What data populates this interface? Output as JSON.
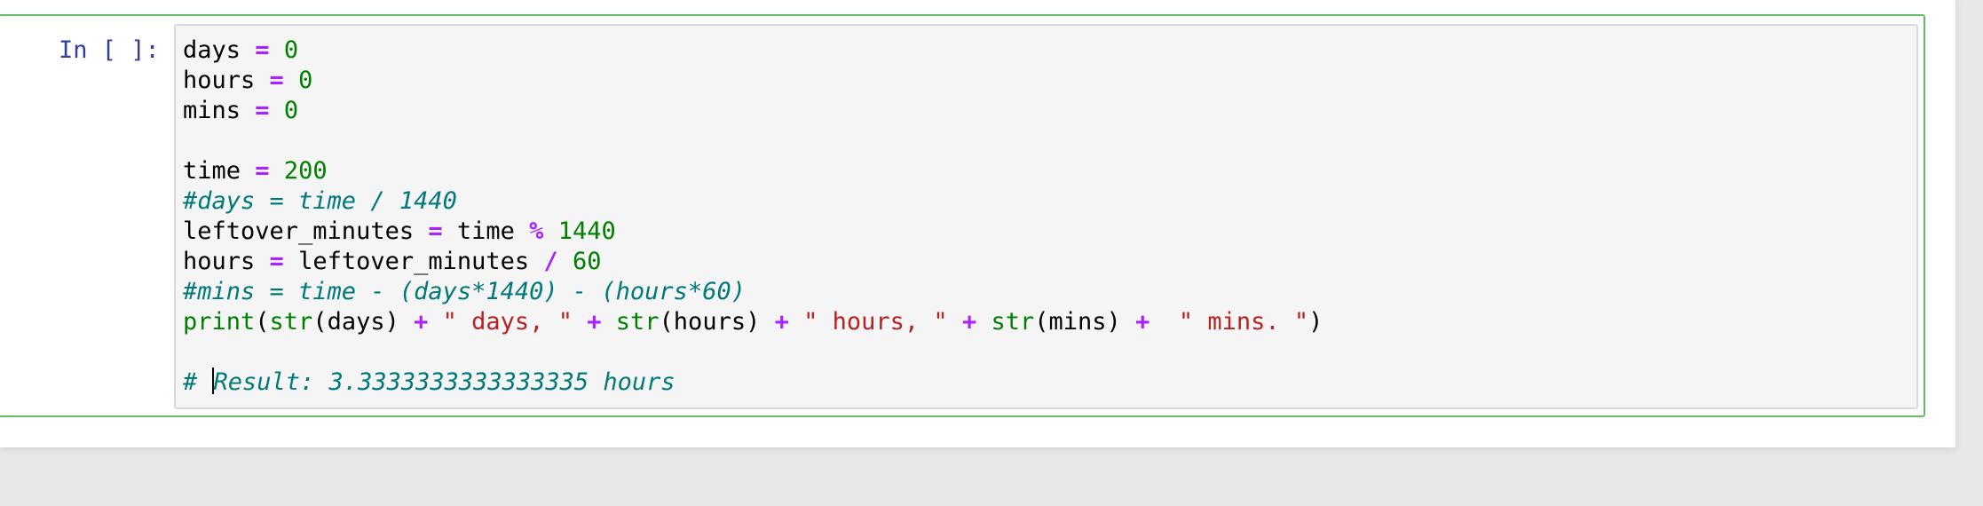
{
  "cell": {
    "prompt": "In [ ]:",
    "lines": [
      {
        "tokens": [
          {
            "t": "days",
            "c": "plain"
          },
          {
            "t": " ",
            "c": "plain"
          },
          {
            "t": "=",
            "c": "op"
          },
          {
            "t": " ",
            "c": "plain"
          },
          {
            "t": "0",
            "c": "num"
          }
        ]
      },
      {
        "tokens": [
          {
            "t": "hours",
            "c": "plain"
          },
          {
            "t": " ",
            "c": "plain"
          },
          {
            "t": "=",
            "c": "op"
          },
          {
            "t": " ",
            "c": "plain"
          },
          {
            "t": "0",
            "c": "num"
          }
        ]
      },
      {
        "tokens": [
          {
            "t": "mins",
            "c": "plain"
          },
          {
            "t": " ",
            "c": "plain"
          },
          {
            "t": "=",
            "c": "op"
          },
          {
            "t": " ",
            "c": "plain"
          },
          {
            "t": "0",
            "c": "num"
          }
        ]
      },
      {
        "tokens": []
      },
      {
        "tokens": [
          {
            "t": "time",
            "c": "plain"
          },
          {
            "t": " ",
            "c": "plain"
          },
          {
            "t": "=",
            "c": "op"
          },
          {
            "t": " ",
            "c": "plain"
          },
          {
            "t": "200",
            "c": "num"
          }
        ]
      },
      {
        "tokens": [
          {
            "t": "#days = time / 1440",
            "c": "comment"
          }
        ]
      },
      {
        "tokens": [
          {
            "t": "leftover_minutes",
            "c": "plain"
          },
          {
            "t": " ",
            "c": "plain"
          },
          {
            "t": "=",
            "c": "op"
          },
          {
            "t": " time ",
            "c": "plain"
          },
          {
            "t": "%",
            "c": "op"
          },
          {
            "t": " ",
            "c": "plain"
          },
          {
            "t": "1440",
            "c": "num"
          }
        ]
      },
      {
        "tokens": [
          {
            "t": "hours",
            "c": "plain"
          },
          {
            "t": " ",
            "c": "plain"
          },
          {
            "t": "=",
            "c": "op"
          },
          {
            "t": " leftover_minutes ",
            "c": "plain"
          },
          {
            "t": "/",
            "c": "op"
          },
          {
            "t": " ",
            "c": "plain"
          },
          {
            "t": "60",
            "c": "num"
          }
        ]
      },
      {
        "tokens": [
          {
            "t": "#mins = time - (days*1440) - (hours*60)",
            "c": "comment"
          }
        ]
      },
      {
        "tokens": [
          {
            "t": "print",
            "c": "builtin"
          },
          {
            "t": "(",
            "c": "plain"
          },
          {
            "t": "str",
            "c": "builtin"
          },
          {
            "t": "(days) ",
            "c": "plain"
          },
          {
            "t": "+",
            "c": "op"
          },
          {
            "t": " ",
            "c": "plain"
          },
          {
            "t": "\" days, \"",
            "c": "str"
          },
          {
            "t": " ",
            "c": "plain"
          },
          {
            "t": "+",
            "c": "op"
          },
          {
            "t": " ",
            "c": "plain"
          },
          {
            "t": "str",
            "c": "builtin"
          },
          {
            "t": "(hours) ",
            "c": "plain"
          },
          {
            "t": "+",
            "c": "op"
          },
          {
            "t": " ",
            "c": "plain"
          },
          {
            "t": "\" hours, \"",
            "c": "str"
          },
          {
            "t": " ",
            "c": "plain"
          },
          {
            "t": "+",
            "c": "op"
          },
          {
            "t": " ",
            "c": "plain"
          },
          {
            "t": "str",
            "c": "builtin"
          },
          {
            "t": "(mins) ",
            "c": "plain"
          },
          {
            "t": "+",
            "c": "op"
          },
          {
            "t": "  ",
            "c": "plain"
          },
          {
            "t": "\" mins. \"",
            "c": "str"
          },
          {
            "t": ")",
            "c": "plain"
          }
        ]
      },
      {
        "tokens": []
      },
      {
        "tokens": [
          {
            "t": "# ",
            "c": "comment"
          },
          {
            "t": "",
            "c": "cursor"
          },
          {
            "t": "Result: 3.3333333333333335 hours",
            "c": "comment"
          }
        ]
      }
    ]
  }
}
